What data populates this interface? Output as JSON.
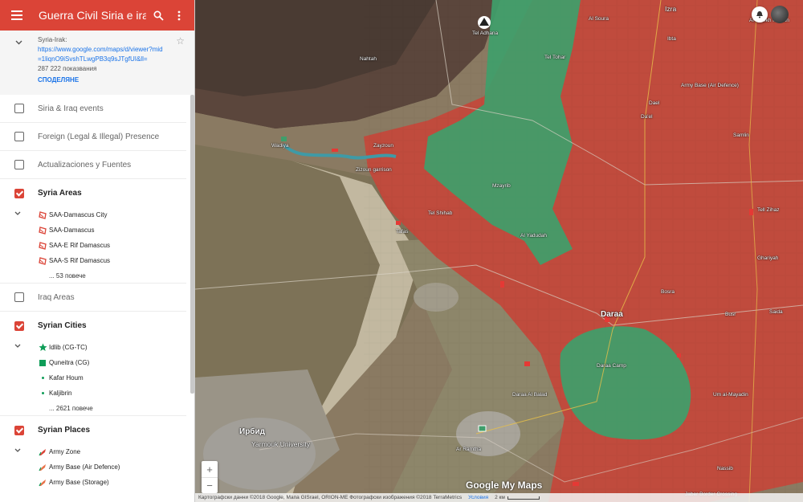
{
  "header": {
    "title": "Guerra Civil Siria e irak",
    "menu_icon": "hamburger-menu-icon",
    "search_icon": "search-icon",
    "more_icon": "more-vert-icon",
    "color": "#db4437"
  },
  "info": {
    "name": "Syria-Irak:",
    "url": "https://www.google.com/maps/d/viewer?mid=1liqnO9iSvshTLwgPB3q9sJTgfUI&ll=",
    "views": "287 222 показвания",
    "share": "СПОДЕЛЯНЕ"
  },
  "layers": [
    {
      "label": "Siria & Iraq events",
      "checked": false
    },
    {
      "label": "Foreign (Legal & Illegal) Presence",
      "checked": false
    },
    {
      "label": "Actualizaciones y Fuentes",
      "checked": false
    },
    {
      "label": "Syria Areas",
      "checked": true,
      "items": [
        "SAA-Damascus City",
        "SAA-Damascus",
        "SAA-E Rif Damascus",
        "SAA-S Rif Damascus"
      ],
      "more": "... 53 повече"
    },
    {
      "label": "Iraq Areas",
      "checked": false
    },
    {
      "label": "Syrian Cities",
      "checked": true,
      "items": [
        "Idlib (CG-TC)",
        "Quneitra (CG)",
        "Kafar Houm",
        "Kaljibrin"
      ],
      "more": "... 2621 повече"
    },
    {
      "label": "Syrian Places",
      "checked": true,
      "items": [
        "Army Zone",
        "Army Base (Air Defence)",
        "Army Base (Storage)"
      ]
    }
  ],
  "map": {
    "labels": [
      {
        "t": "Tel Adhana"
      },
      {
        "t": "Nahtah"
      },
      {
        "t": "Al Soura"
      },
      {
        "t": "Tel Tohar"
      },
      {
        "t": "Wadiya"
      },
      {
        "t": "Zayzoun"
      },
      {
        "t": "Zizoun garrison"
      },
      {
        "t": "Tel Shihab"
      },
      {
        "t": "Tafas"
      },
      {
        "t": "Mzayrib"
      },
      {
        "t": "Al Yadudah"
      },
      {
        "t": "Daraa"
      },
      {
        "t": "Izra"
      },
      {
        "t": "Al Sheikh Maskin"
      },
      {
        "t": "Ibta"
      },
      {
        "t": "Dael"
      },
      {
        "t": "Da'el"
      },
      {
        "t": "Army Base (Air Defence)"
      },
      {
        "t": "Samlin"
      },
      {
        "t": "Tell Zihaz"
      },
      {
        "t": "Ghariyah"
      },
      {
        "t": "Bosra"
      },
      {
        "t": "Jaber Border Crossing"
      },
      {
        "t": "Nassib"
      },
      {
        "t": "Um al-Mayadin"
      },
      {
        "t": "Ирбид"
      },
      {
        "t": "Yarmouk University"
      },
      {
        "t": "Ar Ramtha"
      },
      {
        "t": "Daraa Camp"
      },
      {
        "t": "Daraa Al Balad"
      },
      {
        "t": "Busr"
      },
      {
        "t": "Saida"
      }
    ]
  },
  "footer": {
    "attribution": "Картографски данни ©2018 Google, Мапа GISrael, ORION-ME Фотографски изображения ©2018 TerraMetrics",
    "terms": "Условия",
    "scale": "2 км",
    "logo": "Google My Maps"
  },
  "zoom": {
    "in": "+",
    "out": "−"
  },
  "colors": {
    "saa_area": "#c4473a",
    "rebel_area": "#3f9e6b",
    "accent": "#db4437"
  }
}
